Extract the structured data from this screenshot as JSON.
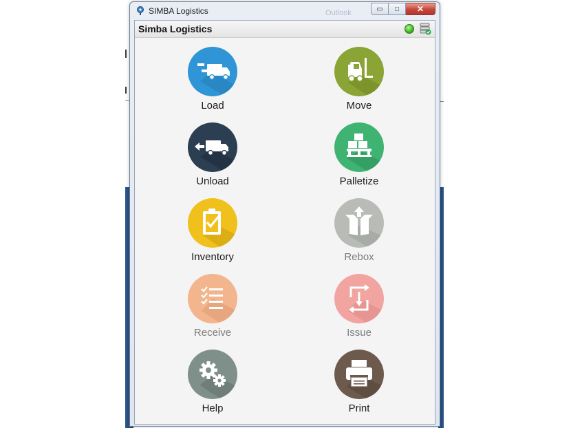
{
  "window": {
    "title": "SIMBA Logistics",
    "background_title": "Outlook",
    "min_glyph": "▭",
    "max_glyph": "□",
    "close_glyph": "✕"
  },
  "app": {
    "header_title": "Simba Logistics",
    "status_icon": "green-status-dot",
    "server_icon": "server-check-icon"
  },
  "menu": [
    {
      "label": "Load",
      "icon": "truck-load-icon",
      "color": "#2f95d6",
      "enabled": true
    },
    {
      "label": "Move",
      "icon": "forklift-icon",
      "color": "#8aa535",
      "enabled": true
    },
    {
      "label": "Unload",
      "icon": "truck-unload-icon",
      "color": "#2c3e52",
      "enabled": true
    },
    {
      "label": "Palletize",
      "icon": "pallet-boxes-icon",
      "color": "#3fb371",
      "enabled": true
    },
    {
      "label": "Inventory",
      "icon": "clipboard-check-icon",
      "color": "#f0c11c",
      "enabled": true
    },
    {
      "label": "Rebox",
      "icon": "open-box-icon",
      "color": "#b9bcb6",
      "enabled": false
    },
    {
      "label": "Receive",
      "icon": "checklist-icon",
      "color": "#f2b58e",
      "enabled": false
    },
    {
      "label": "Issue",
      "icon": "transfer-arrows-icon",
      "color": "#f2a4a1",
      "enabled": false
    },
    {
      "label": "Help",
      "icon": "gears-icon",
      "color": "#7f8f89",
      "enabled": true
    },
    {
      "label": "Print",
      "icon": "printer-icon",
      "color": "#6d5a4d",
      "enabled": true
    }
  ]
}
